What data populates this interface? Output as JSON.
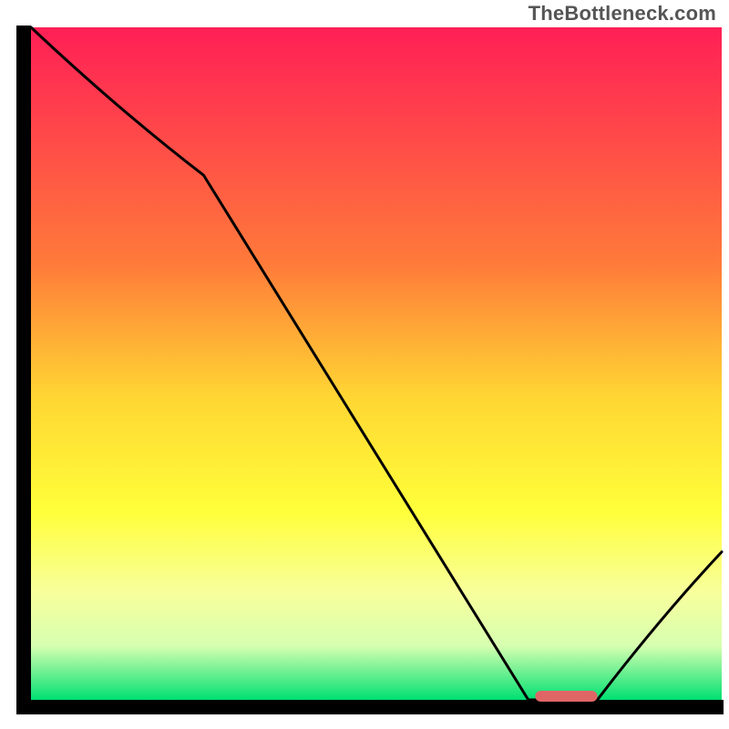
{
  "watermark": "TheBottleneck.com",
  "chart_data": {
    "type": "line",
    "title": "",
    "xlabel": "",
    "ylabel": "",
    "xlim": [
      0,
      100
    ],
    "ylim": [
      0,
      100
    ],
    "x": [
      0,
      25,
      72,
      82,
      100
    ],
    "values": [
      100,
      78,
      0,
      0,
      22
    ],
    "marker": {
      "x_range": [
        73,
        82
      ],
      "y": 0,
      "color": "#e06666"
    },
    "gradient_stops": [
      {
        "offset": 0,
        "color": "#ff1f56"
      },
      {
        "offset": 35,
        "color": "#ff7a3a"
      },
      {
        "offset": 55,
        "color": "#ffd633"
      },
      {
        "offset": 72,
        "color": "#ffff3a"
      },
      {
        "offset": 84,
        "color": "#f8ff9c"
      },
      {
        "offset": 92,
        "color": "#d6ffb0"
      },
      {
        "offset": 100,
        "color": "#00e072"
      }
    ],
    "axis_color": "#000000"
  }
}
